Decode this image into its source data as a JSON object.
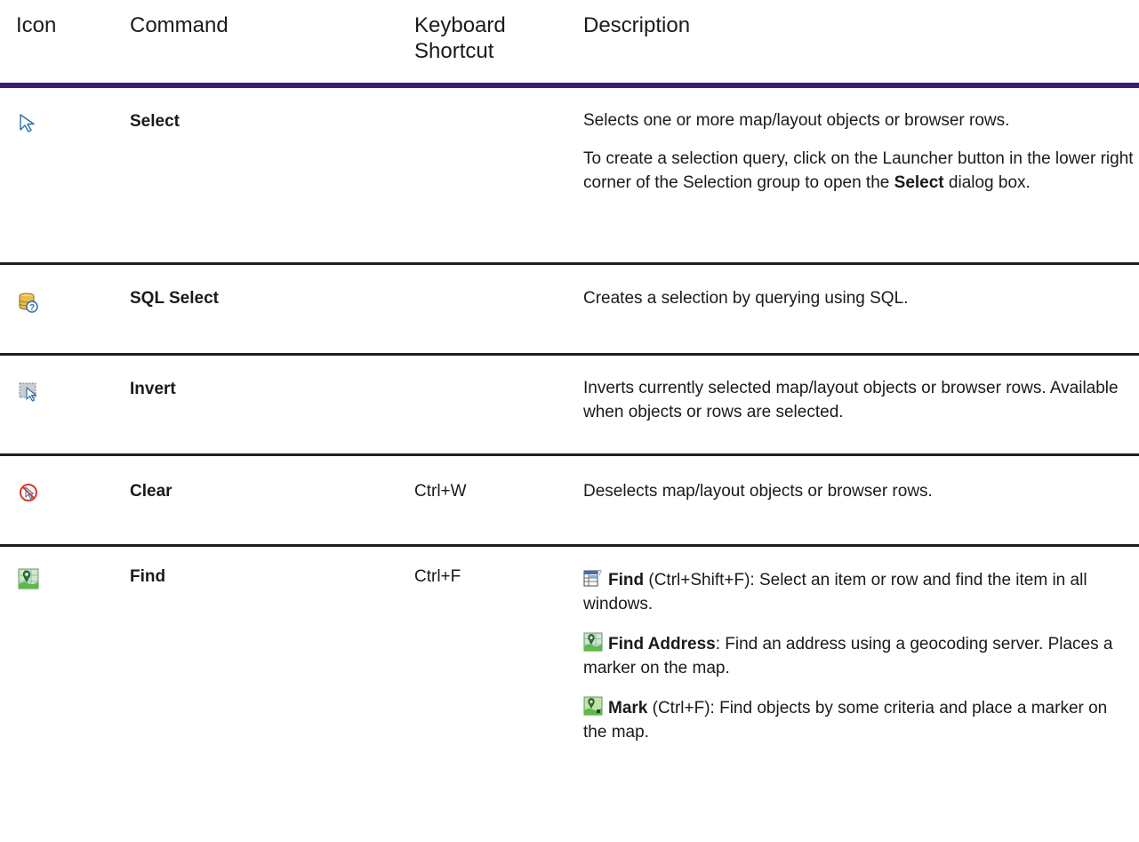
{
  "headers": {
    "icon": "Icon",
    "command": "Command",
    "shortcut_line1": "Keyboard",
    "shortcut_line2": "Shortcut",
    "description": "Description"
  },
  "rows": [
    {
      "icon": "select-arrow-icon",
      "command": "Select",
      "shortcut": "",
      "desc_p1": "Selects one or more map/layout objects or browser rows.",
      "desc_p2_a": "To create a selection query, click on the Launcher button in the lower right corner of the Selection group to open the ",
      "desc_p2_bold": "Select",
      "desc_p2_b": " dialog box."
    },
    {
      "icon": "sql-select-icon",
      "command": "SQL Select",
      "shortcut": "",
      "desc": "Creates a selection by querying using SQL."
    },
    {
      "icon": "invert-selection-icon",
      "command": "Invert",
      "shortcut": "",
      "desc": "Inverts currently selected map/layout objects or browser rows. Available when objects or rows are selected."
    },
    {
      "icon": "clear-selection-icon",
      "command": "Clear",
      "shortcut": "Ctrl+W",
      "desc": "Deselects map/layout objects or browser rows."
    },
    {
      "icon": "find-map-pin-icon",
      "command": "Find",
      "shortcut": "Ctrl+F",
      "sub": [
        {
          "icon": "find-table-icon",
          "title": "Find",
          "rest": " (Ctrl+Shift+F): Select an item or row and find the item in all windows."
        },
        {
          "icon": "find-address-icon",
          "title": "Find Address",
          "rest": ": Find an address using a geocoding server. Places a marker on the map."
        },
        {
          "icon": "mark-icon",
          "title": "Mark",
          "rest": " (Ctrl+F): Find objects by some criteria and place a marker on the map."
        }
      ]
    }
  ],
  "colors": {
    "header_rule": "#3b1a74",
    "row_rule": "#1f1f1f",
    "text": "#1a1a1a"
  }
}
